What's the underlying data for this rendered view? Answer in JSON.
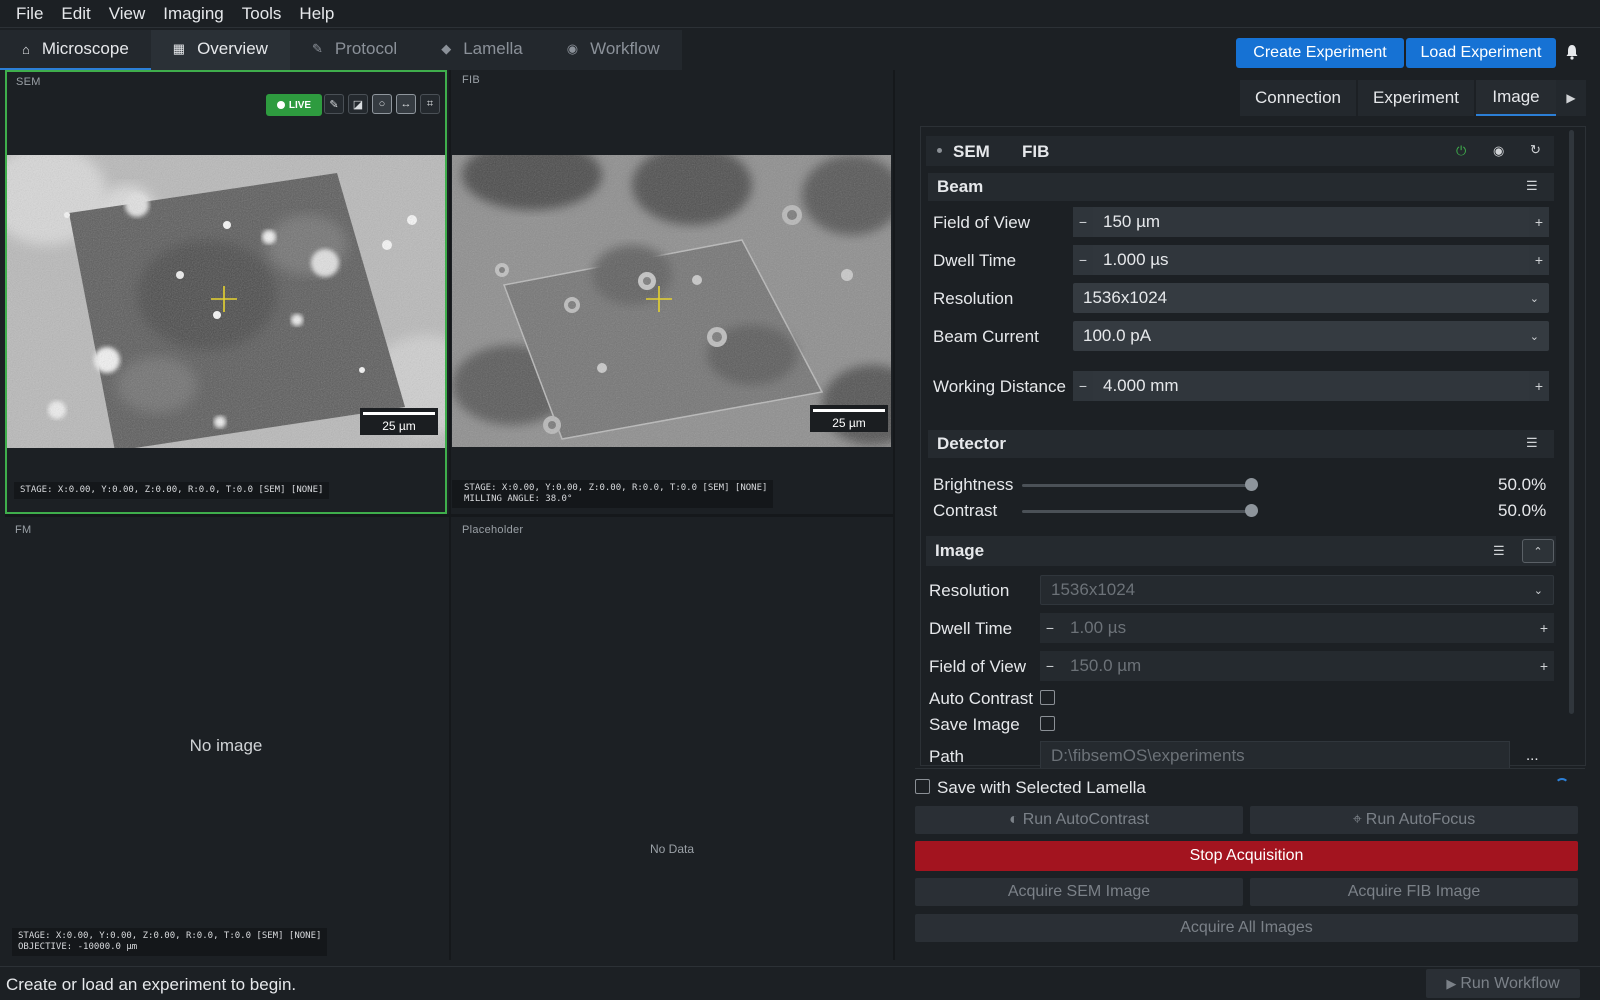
{
  "menu": [
    "File",
    "Edit",
    "View",
    "Imaging",
    "Tools",
    "Help"
  ],
  "main_tabs": [
    {
      "label": "Microscope",
      "icon": "microscope-icon",
      "glyph": "⌂"
    },
    {
      "label": "Overview",
      "icon": "map-icon",
      "glyph": "▦"
    },
    {
      "label": "Protocol",
      "icon": "document-icon",
      "glyph": "✎"
    },
    {
      "label": "Lamella",
      "icon": "layers-icon",
      "glyph": "◆"
    },
    {
      "label": "Workflow",
      "icon": "play-circle-icon",
      "glyph": "◉"
    }
  ],
  "header_buttons": {
    "create": "Create Experiment",
    "load": "Load Experiment"
  },
  "viewers": {
    "sem": {
      "label": "SEM",
      "live": "LIVE",
      "scale": "25 µm",
      "stage": "STAGE: X:0.00, Y:0.00, Z:0.00, R:0.0, T:0.0 [SEM] [NONE]"
    },
    "fib": {
      "label": "FIB",
      "scale": "25 µm",
      "stage": "STAGE: X:0.00, Y:0.00, Z:0.00, R:0.0, T:0.0 [SEM] [NONE]\nMILLING ANGLE: 38.0°"
    },
    "fm": {
      "label": "FM",
      "empty": "No image",
      "stage": "STAGE: X:0.00, Y:0.00, Z:0.00, R:0.0, T:0.0 [SEM] [NONE]\nOBJECTIVE: -10000.0 µm"
    },
    "placeholder": {
      "label": "Placeholder",
      "empty": "No Data"
    }
  },
  "right_tabs": [
    "Connection",
    "Experiment",
    "Image"
  ],
  "beam_select": {
    "sem": "SEM",
    "fib": "FIB"
  },
  "beam": {
    "title": "Beam",
    "fov_label": "Field of View",
    "fov": "150 µm",
    "dwell_label": "Dwell Time",
    "dwell": "1.000 µs",
    "res_label": "Resolution",
    "res": "1536x1024",
    "current_label": "Beam Current",
    "current": "100.0 pA",
    "wd_label": "Working Distance",
    "wd": "4.000 mm"
  },
  "detector": {
    "title": "Detector",
    "brightness_label": "Brightness",
    "brightness": "50.0%",
    "contrast_label": "Contrast",
    "contrast": "50.0%",
    "brightness_level": 0.5,
    "contrast_level": 0.5
  },
  "image": {
    "title": "Image",
    "res_label": "Resolution",
    "res": "1536x1024",
    "dwell_label": "Dwell Time",
    "dwell": "1.00 µs",
    "fov_label": "Field of View",
    "fov": "150.0 µm",
    "autocontrast_label": "Auto Contrast",
    "save_label": "Save Image",
    "path_label": "Path",
    "path": "D:\\fibsemOS\\experiments",
    "browse": "..."
  },
  "save_lamella_label": "Save with Selected Lamella",
  "actions": {
    "autocontrast": "Run AutoContrast",
    "autofocus": "Run AutoFocus",
    "stop": "Stop Acquisition",
    "acq_sem": "Acquire SEM Image",
    "acq_fib": "Acquire FIB Image",
    "acq_all": "Acquire All Images"
  },
  "status": {
    "message": "Create or load an experiment to begin.",
    "run_workflow": "Run Workflow"
  },
  "colors": {
    "accent": "#1672d4",
    "live": "#2e9b3f",
    "stop": "#a3141f",
    "crosshair": "#e5d230"
  }
}
